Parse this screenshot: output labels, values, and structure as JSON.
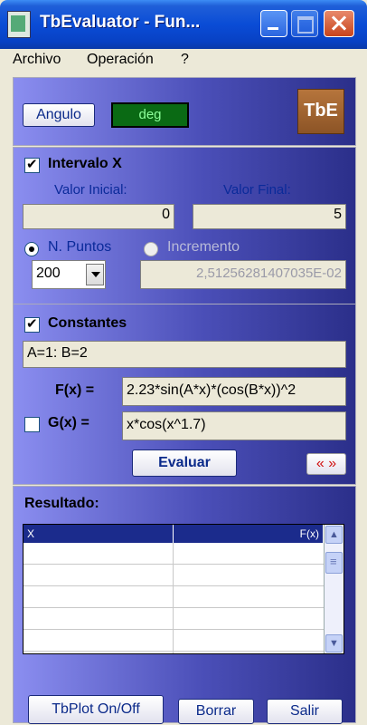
{
  "window": {
    "title": "TbEvaluator  -  Fun...",
    "icon": "app-icon"
  },
  "menu": {
    "items": [
      "Archivo",
      "Operación",
      "?"
    ]
  },
  "angulo": {
    "button_label": "Angulo",
    "unit_display": "deg",
    "logo_text": "TbE"
  },
  "intervalo": {
    "title": "Intervalo X",
    "checked": true,
    "valor_inicial_label": "Valor Inicial:",
    "valor_final_label": "Valor Final:",
    "valor_inicial": "0",
    "valor_final": "5",
    "npuntos_label": "N. Puntos",
    "incremento_label": "Incremento",
    "npuntos_value": "200",
    "incremento_value": "2,51256281407035E-02"
  },
  "constantes": {
    "title": "Constantes",
    "checked": true,
    "value": "A=1: B=2",
    "fx_label": "F(x) =",
    "fx_value": "2.23*sin(A*x)*(cos(B*x))^2",
    "gx_label": "G(x) =",
    "gx_checked": false,
    "gx_value": "x*cos(x^1.7)",
    "evaluar_label": "Evaluar",
    "toggle_label": "« »"
  },
  "resultado": {
    "title": "Resultado:",
    "columns": [
      "X",
      "F(x)"
    ],
    "rows": [
      [],
      [],
      [],
      [],
      []
    ],
    "buttons": {
      "tbplot": "TbPlot On/Off",
      "borrar": "Borrar",
      "salir": "Salir"
    }
  },
  "colors": {
    "titlebar": "#0a4cd6",
    "panel_light": "#8b8ef0",
    "panel_dark": "#2b2f8a",
    "deg_bg": "#0a6a14",
    "deg_text": "#8dff9a",
    "toggle_text": "#d01010"
  }
}
